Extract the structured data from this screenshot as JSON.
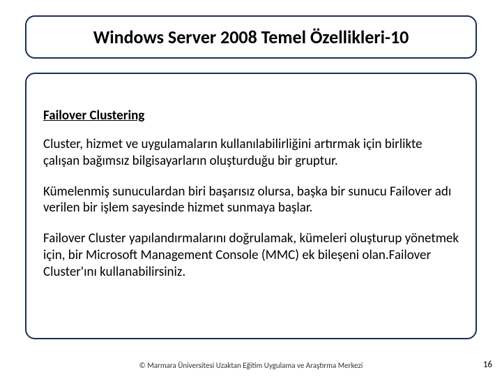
{
  "title": "Windows Server 2008 Temel Özellikleri-10",
  "subheading": "Failover Clustering",
  "paragraphs": [
    "Cluster, hizmet ve uygulamaların kullanılabilirliğini artırmak için birlikte çalışan bağımsız bilgisayarların oluşturduğu bir gruptur.",
    "Kümelenmiş sunuculardan biri başarısız olursa, başka bir sunucu Failover adı verilen bir işlem sayesinde hizmet sunmaya başlar.",
    "Failover Cluster yapılandırmalarını doğrulamak, kümeleri oluşturup yönetmek için, bir Microsoft Management Console (MMC) ek bileşeni olan.Failover Cluster'ını kullanabilirsiniz."
  ],
  "footer": "© Marmara Üniversitesi Uzaktan Eğitim Uygulama ve Araştırma Merkezi",
  "page_number": "16"
}
